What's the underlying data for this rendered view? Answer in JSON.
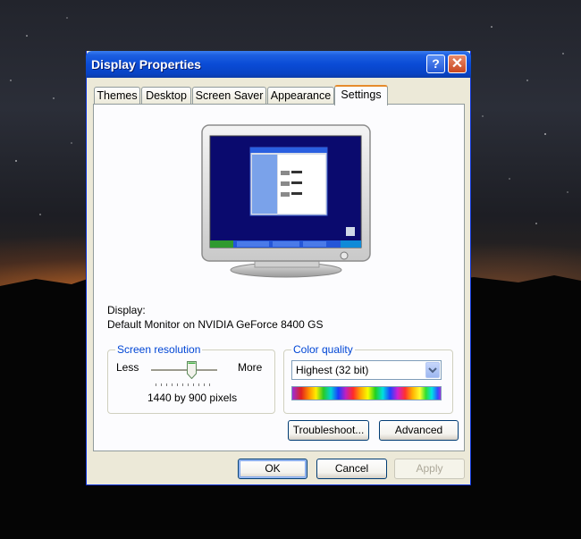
{
  "window": {
    "title": "Display Properties",
    "help_label": "?",
    "close_label": "✕"
  },
  "tabs": [
    {
      "label": "Themes",
      "active": false
    },
    {
      "label": "Desktop",
      "active": false
    },
    {
      "label": "Screen Saver",
      "active": false
    },
    {
      "label": "Appearance",
      "active": false
    },
    {
      "label": "Settings",
      "active": true
    }
  ],
  "display": {
    "label": "Display:",
    "device": "Default Monitor on NVIDIA GeForce 8400 GS"
  },
  "resolution": {
    "group_title": "Screen resolution",
    "less_label": "Less",
    "more_label": "More",
    "value_text": "1440 by 900 pixels",
    "slider_level": 0.62
  },
  "color_quality": {
    "group_title": "Color quality",
    "selected": "Highest (32 bit)"
  },
  "buttons": {
    "troubleshoot": "Troubleshoot...",
    "advanced": "Advanced",
    "ok": "OK",
    "cancel": "Cancel",
    "apply": "Apply"
  },
  "colors": {
    "titlebar": "#0a4bd6",
    "window_bg": "#ece9d8",
    "panel_bg": "#fcfcfe",
    "group_title": "#0046d5",
    "active_tab_accent": "#e68b2c"
  }
}
